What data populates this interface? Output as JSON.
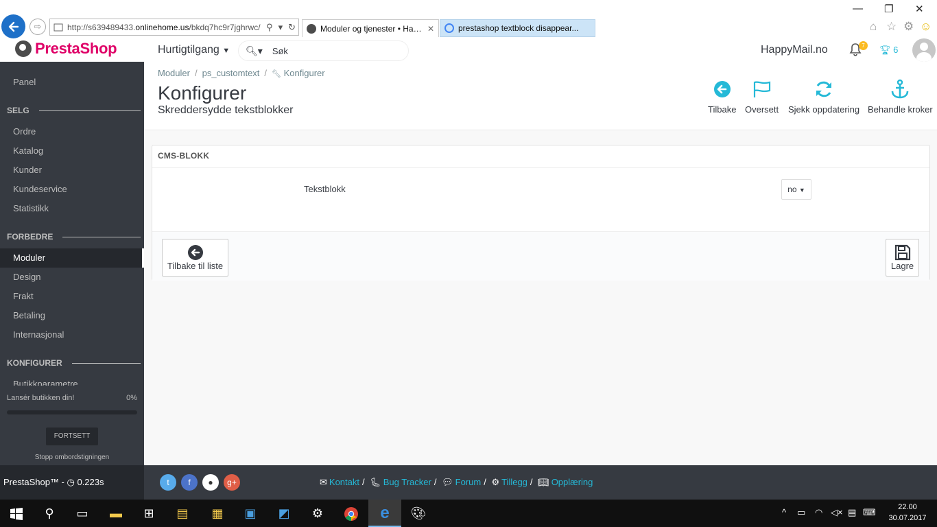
{
  "browser": {
    "url_prefix": "http://s639489433.",
    "url_domain": "onlinehome.us",
    "url_suffix": "/bkdq7hc9r7jghrwc/",
    "tabs": [
      {
        "label": "Moduler og tjenester • Hap...",
        "active": true
      },
      {
        "label": "prestashop textblock disappear...",
        "active": false
      }
    ]
  },
  "header": {
    "logo_text": "PrestaShop",
    "quick_access": "Hurtigtilgang",
    "search_placeholder": "Søk",
    "shop_name": "HappyMail.no",
    "notifications_count": "7",
    "trophy_count": "6"
  },
  "sidebar": {
    "items": [
      {
        "label": "Panel"
      },
      {
        "section": "SELG"
      },
      {
        "label": "Ordre"
      },
      {
        "label": "Katalog"
      },
      {
        "label": "Kunder"
      },
      {
        "label": "Kundeservice"
      },
      {
        "label": "Statistikk"
      },
      {
        "section": "FORBEDRE"
      },
      {
        "label": "Moduler",
        "active": true
      },
      {
        "label": "Design"
      },
      {
        "label": "Frakt"
      },
      {
        "label": "Betaling"
      },
      {
        "label": "Internasjonal"
      },
      {
        "section": "KONFIGURER"
      },
      {
        "label": "Butikkparametre"
      }
    ],
    "onboarding": {
      "text": "Lansér butikken din!",
      "percent": "0%",
      "progress": 0,
      "button": "FORTSETT",
      "stop": "Stopp ombordstigningen"
    }
  },
  "page": {
    "breadcrumb": [
      "Moduler",
      "ps_customtext",
      "Konfigurer"
    ],
    "title": "Konfigurer",
    "subtitle": "Skreddersydde tekstblokker",
    "toolbar": [
      {
        "label": "Tilbake",
        "icon": "arrow-circle-left-icon"
      },
      {
        "label": "Oversett",
        "icon": "flag-icon"
      },
      {
        "label": "Sjekk oppdatering",
        "icon": "refresh-icon"
      },
      {
        "label": "Behandle kroker",
        "icon": "anchor-icon"
      }
    ]
  },
  "panel": {
    "heading": "CMS-BLOKK",
    "field_label": "Tekstblokk",
    "language": "no",
    "back_button": "Tilbake til liste",
    "save_button": "Lagre"
  },
  "footer": {
    "version": "PrestaShop™ - ",
    "time": "0.223s",
    "links": [
      "Kontakt",
      "Bug Tracker",
      "Forum",
      "Tillegg",
      "Opplæring"
    ]
  },
  "taskbar": {
    "time": "22.00",
    "date": "30.07.2017"
  },
  "colors": {
    "accent": "#25b9d7",
    "brand": "#df0067",
    "sidebar_bg": "#363a41"
  }
}
